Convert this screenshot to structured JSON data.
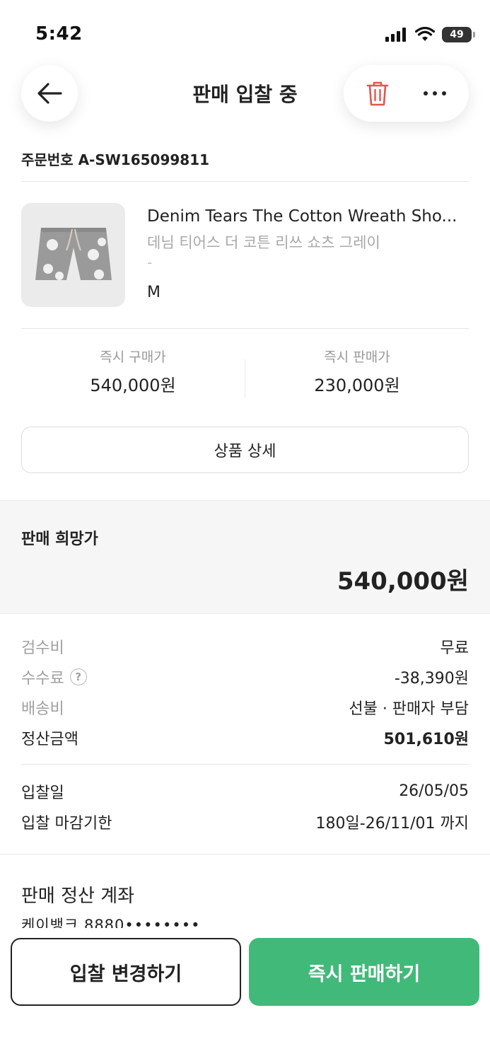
{
  "status_bar": {
    "time": "5:42",
    "battery": "49"
  },
  "header": {
    "title": "판매 입찰 중"
  },
  "order": {
    "number_label": "주문번호 A-SW165099811"
  },
  "product": {
    "name": "Denim Tears The Cotton Wreath Sho...",
    "name_ko": "데님 티어스 더 코튼 리쓰 쇼츠 그레이",
    "option": "-",
    "size": "M"
  },
  "prices": {
    "buy_now_label": "즉시 구매가",
    "buy_now_value": "540,000원",
    "sell_now_label": "즉시 판매가",
    "sell_now_value": "230,000원"
  },
  "detail_button_label": "상품 상세",
  "wish_price": {
    "label": "판매 희망가",
    "value": "540,000원"
  },
  "fees": [
    {
      "label": "검수비",
      "value": "무료"
    },
    {
      "label": "수수료",
      "value": "-38,390원"
    },
    {
      "label": "배송비",
      "value": "선불 · 판매자 부담"
    },
    {
      "label": "정산금액",
      "value": "501,610원"
    }
  ],
  "bid_info": [
    {
      "label": "입찰일",
      "value": "26/05/05"
    },
    {
      "label": "입찰 마감기한",
      "value": "180일-26/11/01 까지"
    }
  ],
  "account": {
    "title": "판매 정산 계좌",
    "value": "케이뱅크 8880••••••••"
  },
  "actions": {
    "change_bid": "입찰 변경하기",
    "sell_now": "즉시 판매하기"
  },
  "colors": {
    "accent_green": "#41b979",
    "delete_red": "#e0574f"
  },
  "icons": [
    "back-arrow-icon",
    "trash-icon",
    "more-icon",
    "signal-icon",
    "wifi-icon",
    "battery-icon",
    "help-icon"
  ]
}
